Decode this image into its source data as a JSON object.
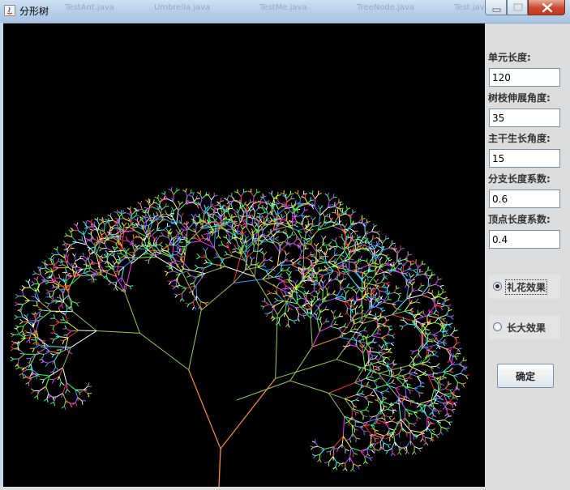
{
  "window": {
    "title": "分形树",
    "ghost_tabs": [
      "TestAnt.java",
      "Umbrella.java",
      "TestMe.java",
      "TreeNode.java",
      "Test.java"
    ]
  },
  "panel": {
    "unit_length": {
      "label": "单元长度:",
      "value": "120"
    },
    "branch_angle": {
      "label": "树枝伸展角度:",
      "value": "35"
    },
    "trunk_angle": {
      "label": "主干生长角度:",
      "value": "15"
    },
    "branch_ratio": {
      "label": "分支长度系数:",
      "value": "0.6"
    },
    "tip_ratio": {
      "label": "顶点长度系数:",
      "value": "0.4"
    },
    "effects": [
      {
        "label": "礼花效果",
        "selected": true
      },
      {
        "label": "长大效果",
        "selected": false
      }
    ],
    "ok_label": "确定"
  },
  "colors": {
    "canvas_bg": "#000000",
    "trunk": "#ff8c3a",
    "mid_branch": "#9ccc4a",
    "leaf_palette": [
      "#ff3333",
      "#33ff66",
      "#3399ff",
      "#ffff33",
      "#ff33ff",
      "#33ffff",
      "#ffffff",
      "#ff9933",
      "#9966ff",
      "#66ff33"
    ]
  }
}
